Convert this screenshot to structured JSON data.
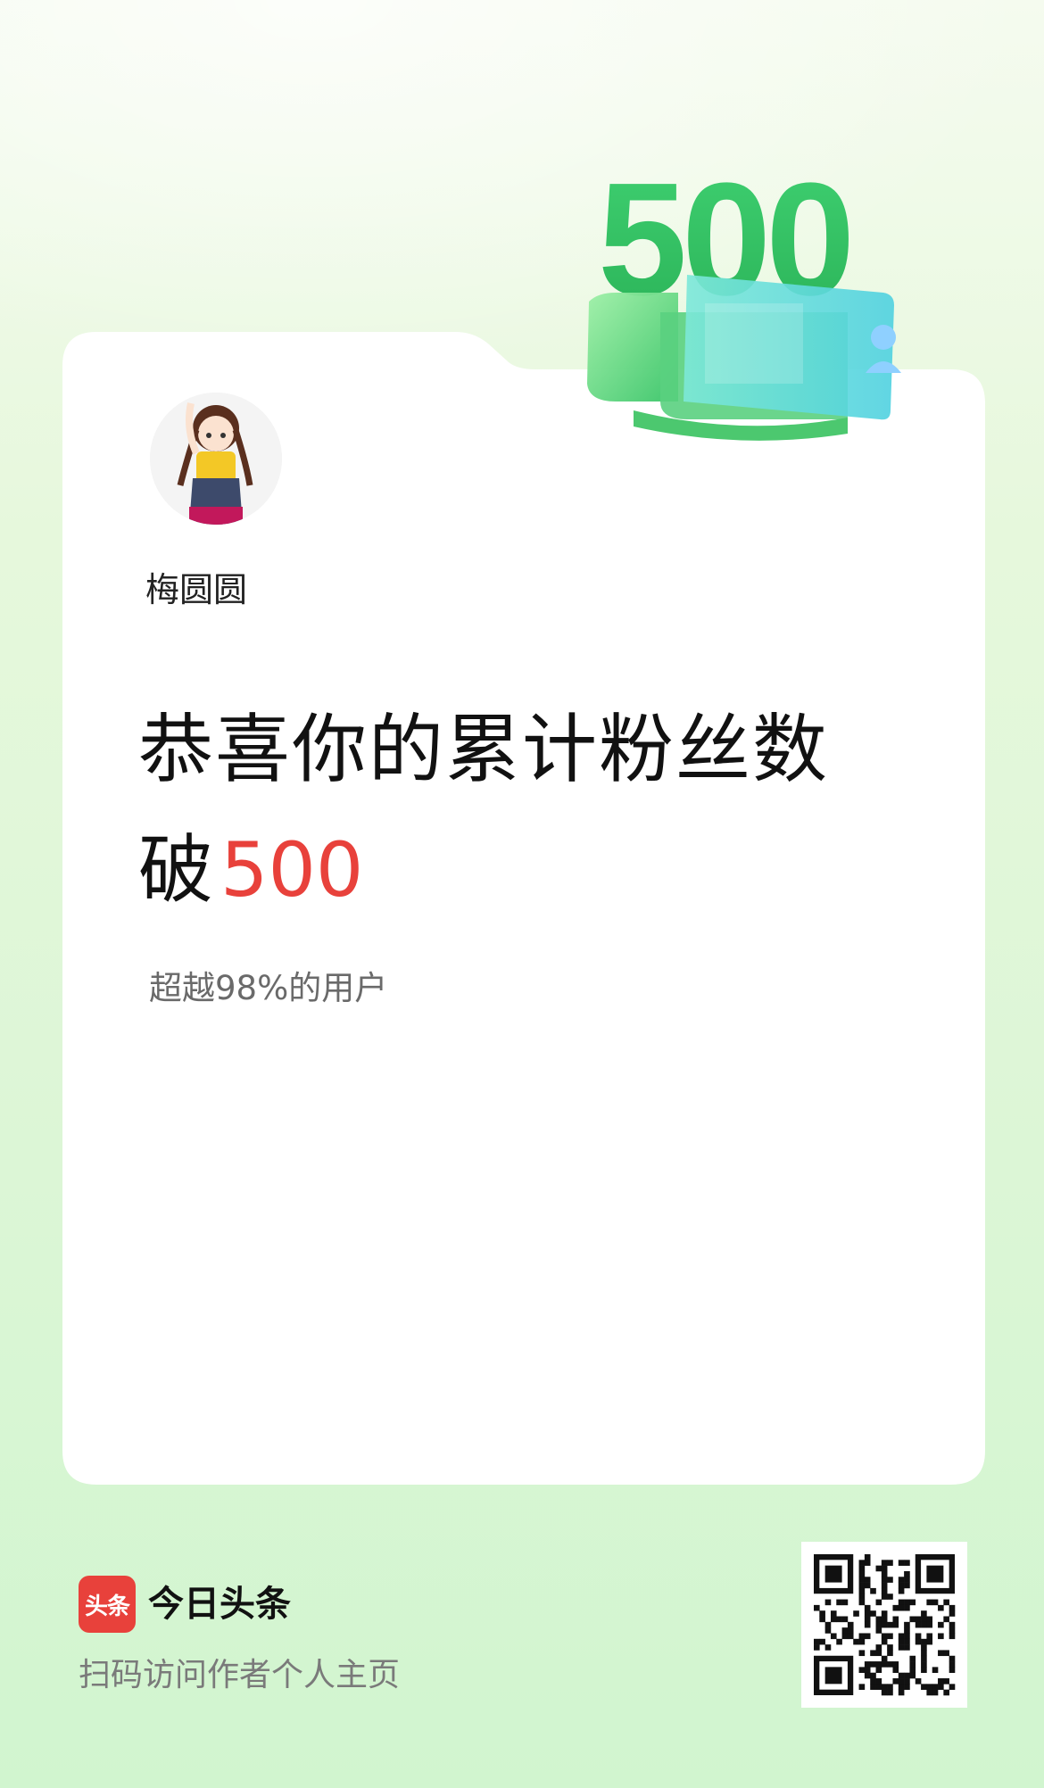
{
  "colors": {
    "accent": "#e8413b",
    "badge_green": "#3ecb6a",
    "card": "#ffffff"
  },
  "badge": {
    "number": "500"
  },
  "user": {
    "name": "梅圆圆"
  },
  "headline": {
    "line1": "恭喜你的累计粉丝数",
    "line2_prefix": "破",
    "count": "500"
  },
  "subtitle": "超越98%的用户",
  "footer": {
    "logo_text": "头条",
    "brand_name": "今日头条",
    "hint": "扫码访问作者个人主页"
  },
  "icons": {
    "avatar": "girl-avatar-icon",
    "qr": "qr-code-icon",
    "badge": "fans-500-badge-icon"
  }
}
